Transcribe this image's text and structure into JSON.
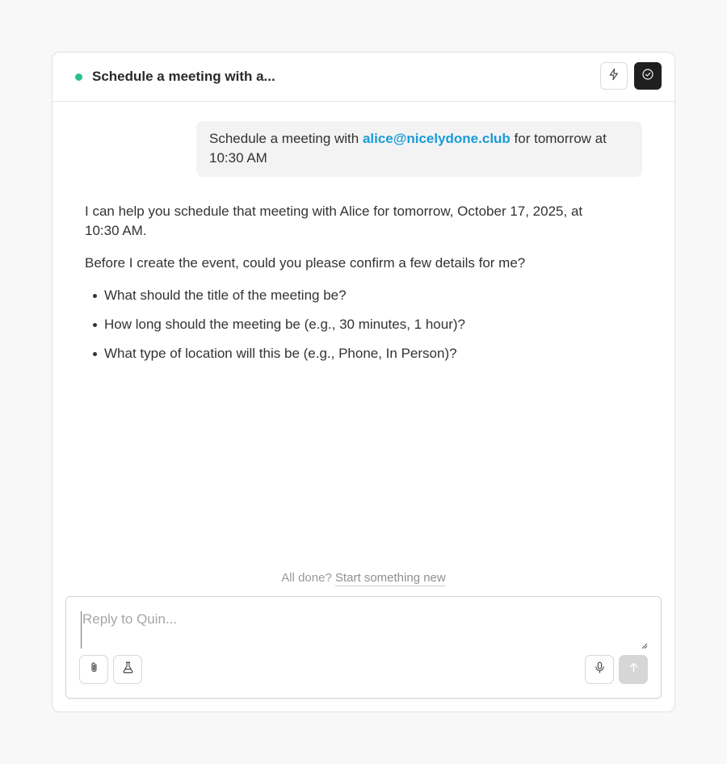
{
  "header": {
    "title": "Schedule a meeting with a...",
    "status_color": "#2cc08b",
    "actions": [
      {
        "icon": "lightning-icon"
      },
      {
        "icon": "check-circle-icon"
      }
    ]
  },
  "user_message": {
    "prefix": "Schedule a meeting with ",
    "email": "alice@nicelydone.club",
    "suffix": " for tomorrow at 10:30 AM"
  },
  "assistant_message": {
    "paragraph1": "I can help you schedule that meeting with Alice for tomorrow, October 17, 2025, at 10:30 AM.",
    "paragraph2": "Before I create the event, could you please confirm a few details for me?",
    "questions": [
      "What should the title of the meeting be?",
      "How long should the meeting be (e.g., 30 minutes, 1 hour)?",
      "What type of location will this be (e.g., Phone, In Person)?"
    ]
  },
  "footer": {
    "done_prefix": "All done?",
    "done_link": "Start something new"
  },
  "composer": {
    "placeholder": "Reply to Quin...",
    "value": "",
    "left_buttons": [
      "paperclip-icon",
      "flask-icon"
    ],
    "right_buttons": [
      "microphone-icon",
      "arrow-up-icon"
    ]
  },
  "colors": {
    "accent_link": "#1a9bd7",
    "dark_button": "#1f1f1f",
    "send_disabled": "#d6d6d6"
  }
}
